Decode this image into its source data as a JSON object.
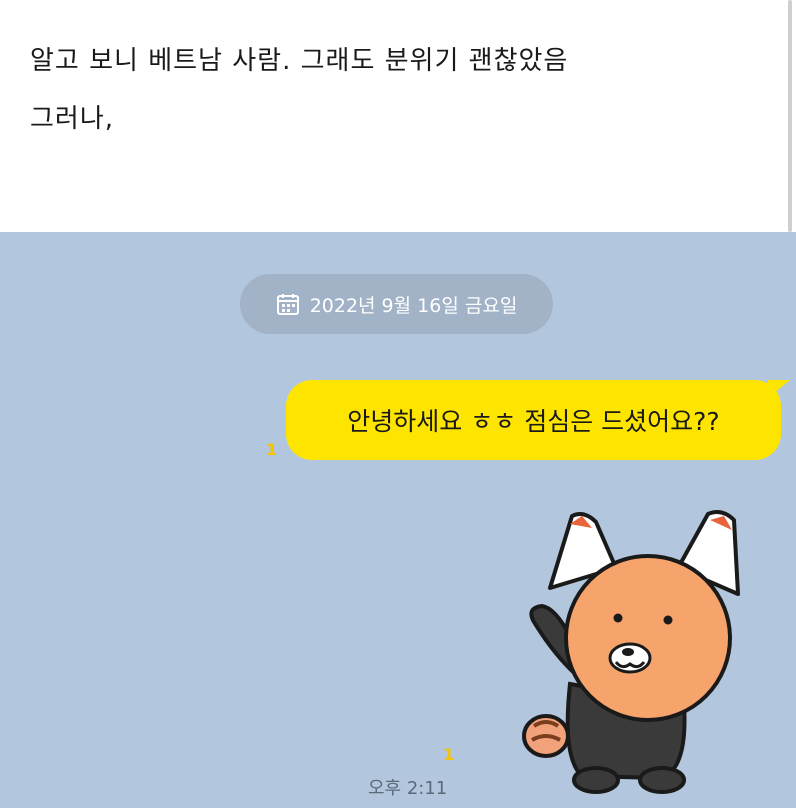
{
  "post": {
    "lines": [
      "알고 보니 베트남 사람. 그래도 분위기 괜찮았음",
      "그러나,"
    ]
  },
  "chat": {
    "date": "2022년 9월 16일 금요일",
    "date_icon": "calendar-icon",
    "message": {
      "text": "안녕하세요 ㅎㅎ 점심은 드셨어요??",
      "unread": "1"
    },
    "sticker": {
      "icon": "red-panda-waving-sticker",
      "unread": "1"
    },
    "time": "오후 2:11",
    "colors": {
      "chat_background": "#b2c6dd",
      "bubble": "#fee500",
      "unread": "#f2c500"
    }
  }
}
